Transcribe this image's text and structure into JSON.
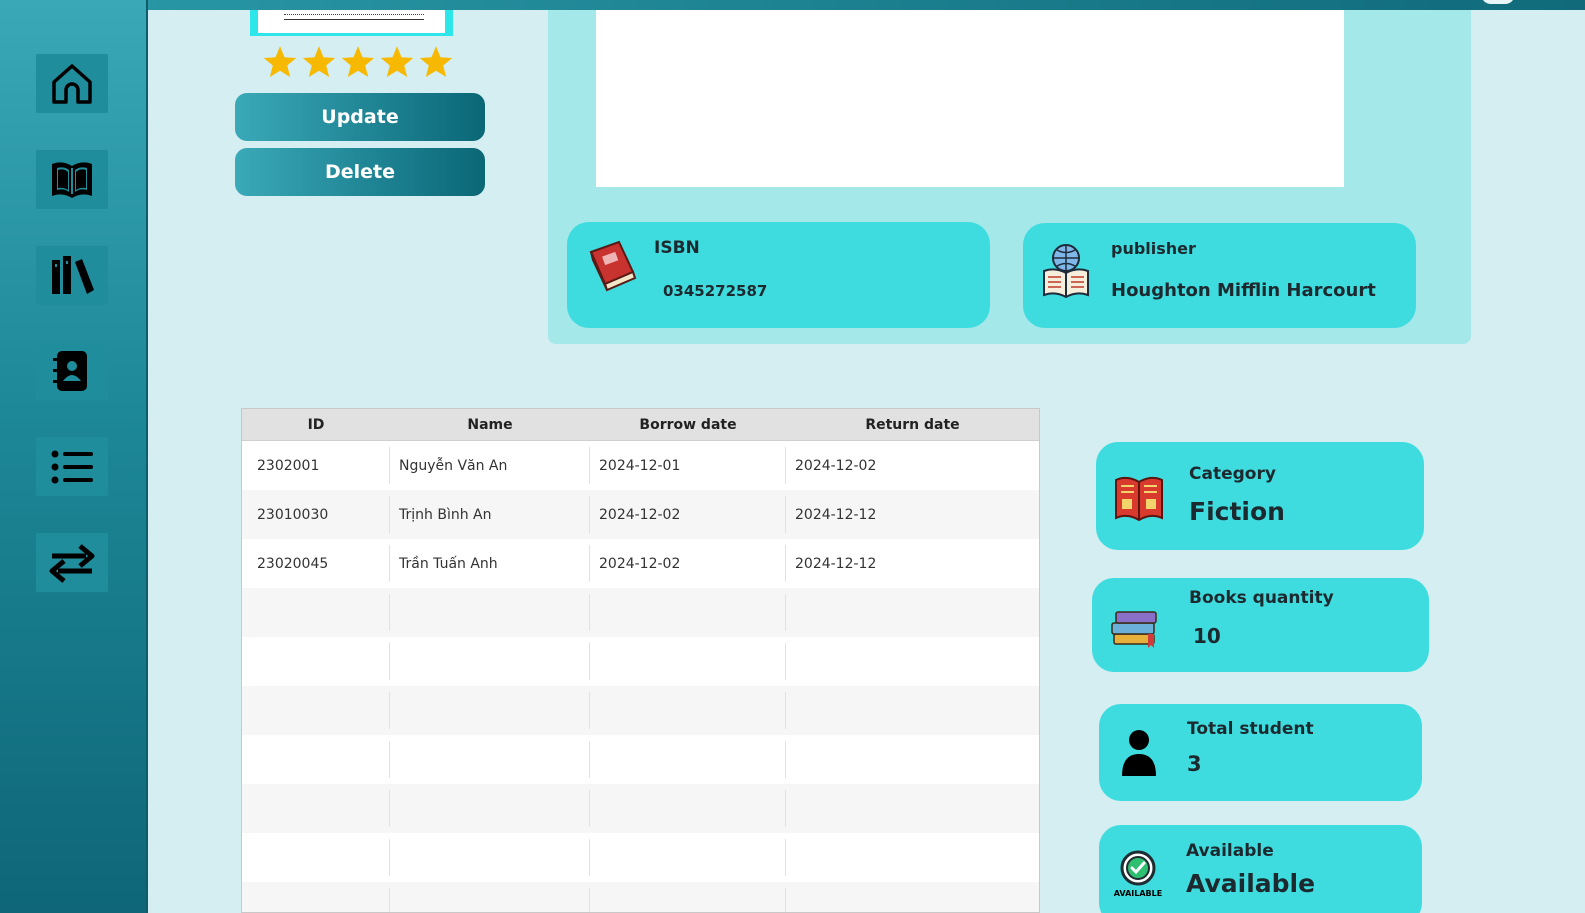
{
  "sidebar": {
    "items": [
      {
        "name": "home-icon"
      },
      {
        "name": "book-icon"
      },
      {
        "name": "library-icon"
      },
      {
        "name": "contacts-icon"
      },
      {
        "name": "list-icon"
      },
      {
        "name": "transfer-icon"
      }
    ]
  },
  "book": {
    "rating": 5,
    "rating_max": 5,
    "update_label": "Update",
    "delete_label": "Delete"
  },
  "details": {
    "isbn_label": "ISBN",
    "isbn_value": "0345272587",
    "publisher_label": "publisher",
    "publisher_value": "Houghton Mifflin Harcourt"
  },
  "table": {
    "headers": [
      "ID",
      "Name",
      "Borrow date",
      "Return date"
    ],
    "rows": [
      [
        "2302001",
        "Nguyễn Văn An",
        "2024-12-01",
        "2024-12-02"
      ],
      [
        "23010030",
        "Trịnh Bình An",
        "2024-12-02",
        "2024-12-12"
      ],
      [
        "23020045",
        "Trần Tuấn Anh",
        "2024-12-02",
        "2024-12-12"
      ]
    ]
  },
  "stats": {
    "category_label": "Category",
    "category_value": "Fiction",
    "quantity_label": "Books quantity",
    "quantity_value": "10",
    "students_label": "Total student",
    "students_value": "3",
    "available_label": "Available",
    "available_value": "Available",
    "available_badge": "AVAILABLE"
  },
  "colors": {
    "accent": "#3fdcdf",
    "sidebar": "#1f8d9c",
    "star": "#f7b900"
  }
}
